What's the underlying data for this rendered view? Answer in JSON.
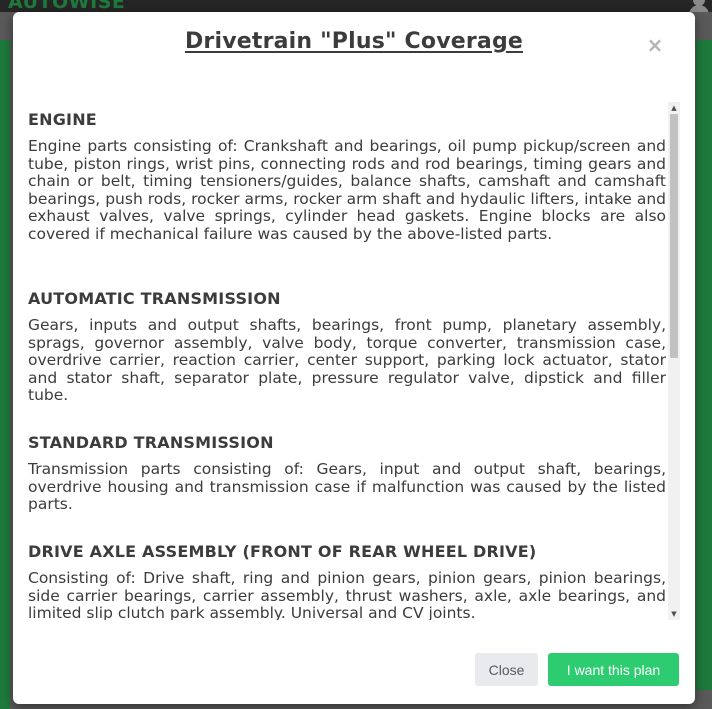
{
  "background": {
    "logo_text": "AUTOWISE",
    "avatar_icon": "user-icon",
    "accent_color": "#1f7a3d"
  },
  "modal": {
    "title": "Drivetrain \"Plus\" Coverage",
    "close_icon": "×",
    "sections": [
      {
        "heading": "ENGINE",
        "body": "Engine parts consisting of: Crankshaft and bearings, oil pump pickup/screen and tube, piston rings, wrist pins, connecting rods and rod bearings, timing gears and chain or belt, timing tensioners/guides, balance shafts, camshaft and camshaft bearings, push rods, rocker arms, rocker arm shaft and hydaulic lifters, intake and exhaust valves, valve springs, cylinder head gaskets. Engine blocks are also covered if mechanical failure was caused by the above-listed parts."
      },
      {
        "heading": "AUTOMATIC TRANSMISSION",
        "body": "Gears, inputs and output shafts, bearings, front pump, planetary assembly, sprags, governor assembly, valve body, torque converter, transmission case, overdrive carrier, reaction carrier, center support, parking lock actuator, stator and stator shaft, separator plate, pressure regulator valve, dipstick and filler tube."
      },
      {
        "heading": "STANDARD TRANSMISSION",
        "body": "Transmission parts consisting of: Gears, input and output shaft, bearings, overdrive housing and transmission case if malfunction was caused by the listed parts."
      },
      {
        "heading": "DRIVE AXLE ASSEMBLY (FRONT OF REAR WHEEL DRIVE)",
        "body": "Consisting of: Drive shaft, ring and pinion gears, pinion gears, pinion bearings, side carrier bearings, carrier assembly, thrust washers, axle, axle bearings, and limited slip clutch park assembly. Universal and CV joints."
      }
    ],
    "buttons": {
      "close_label": "Close",
      "plan_label": "I want this plan"
    },
    "colors": {
      "primary_button": "#2ecc71",
      "secondary_button": "#e8eaed"
    }
  }
}
